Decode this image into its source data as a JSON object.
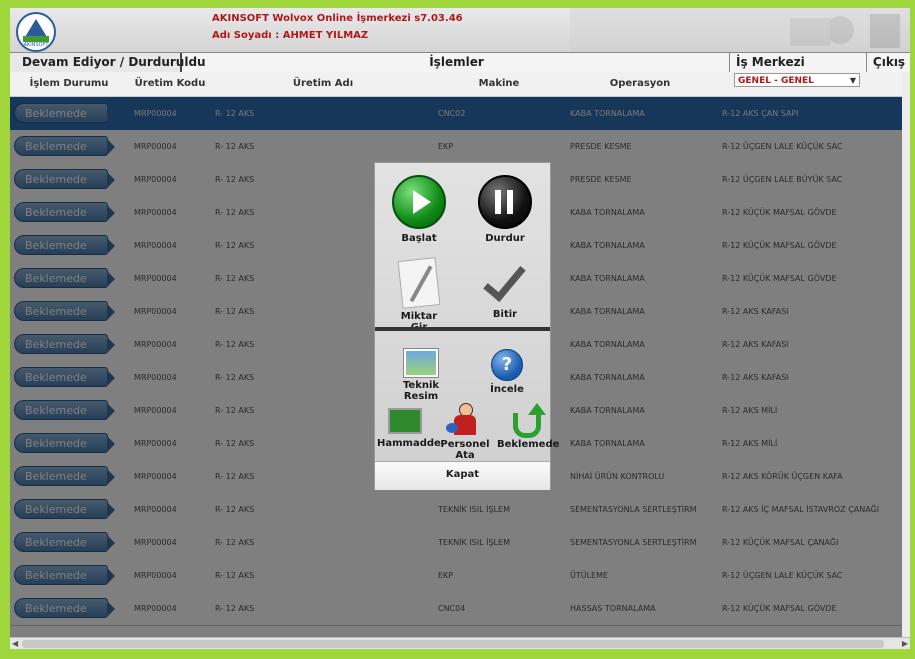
{
  "header": {
    "title": "AKINSOFT Wolvox Online İşmerkezi s7.03.46",
    "user_label": "Adı Soyadı : ",
    "user_name": "AHMET YILMAZ",
    "logo_text": "AKINSOFT"
  },
  "toolbar": {
    "status_tab": "Devam Ediyor / Durduruldu",
    "operations": "İşlemler",
    "work_center": "İş Merkezi",
    "exit": "Çıkış"
  },
  "columns": [
    "İşlem Durumu",
    "Üretim Kodu",
    "Üretim Adı",
    "Makine",
    "Operasyon"
  ],
  "work_center_select": {
    "value": "GENEL - GENEL"
  },
  "rows": [
    {
      "status": "Beklemede",
      "code": "MRP00004",
      "name": "R- 12 AKS",
      "machine": "CNC02",
      "operation": "KABA TORNALAMA",
      "item": "R-12 AKS ÇAN SAPI",
      "selected": true
    },
    {
      "status": "Beklemede",
      "code": "MRP00004",
      "name": "R- 12 AKS",
      "machine": "EKP",
      "operation": "PRESDE KESME",
      "item": "R-12 ÜÇGEN LALE KÜÇÜK SAC"
    },
    {
      "status": "Beklemede",
      "code": "MRP00004",
      "name": "R- 12 AKS",
      "machine": "",
      "operation": "PRESDE KESME",
      "item": "R-12 ÜÇGEN LALE BÜYÜK SAC"
    },
    {
      "status": "Beklemede",
      "code": "MRP00004",
      "name": "R- 12 AKS",
      "machine": "",
      "operation": "KABA TORNALAMA",
      "item": "R-12 KÜÇÜK MAFSAL GÖVDE"
    },
    {
      "status": "Beklemede",
      "code": "MRP00004",
      "name": "R- 12 AKS",
      "machine": "",
      "operation": "KABA TORNALAMA",
      "item": "R-12 KÜÇÜK MAFSAL GÖVDE"
    },
    {
      "status": "Beklemede",
      "code": "MRP00004",
      "name": "R- 12 AKS",
      "machine": "",
      "operation": "KABA TORNALAMA",
      "item": "R-12 KÜÇÜK MAFSAL GÖVDE"
    },
    {
      "status": "Beklemede",
      "code": "MRP00004",
      "name": "R- 12 AKS",
      "machine": "",
      "operation": "KABA TORNALAMA",
      "item": "R-12 AKS KAFASI"
    },
    {
      "status": "Beklemede",
      "code": "MRP00004",
      "name": "R- 12 AKS",
      "machine": "",
      "operation": "KABA TORNALAMA",
      "item": "R-12 AKS KAFASI"
    },
    {
      "status": "Beklemede",
      "code": "MRP00004",
      "name": "R- 12 AKS",
      "machine": "",
      "operation": "KABA TORNALAMA",
      "item": "R-12 AKS KAFASI"
    },
    {
      "status": "Beklemede",
      "code": "MRP00004",
      "name": "R- 12 AKS",
      "machine": "",
      "operation": "KABA TORNALAMA",
      "item": "R-12 AKS MİLİ"
    },
    {
      "status": "Beklemede",
      "code": "MRP00004",
      "name": "R- 12 AKS",
      "machine": "",
      "operation": "KABA TORNALAMA",
      "item": "R-12 AKS MİLİ"
    },
    {
      "status": "Beklemede",
      "code": "MRP00004",
      "name": "R- 12 AKS",
      "machine": "",
      "operation": "NİHAİ ÜRÜN KONTROLU",
      "item": "R-12 AKS KÖRÜK ÜÇGEN KAFA"
    },
    {
      "status": "Beklemede",
      "code": "MRP00004",
      "name": "R- 12 AKS",
      "machine": "TEKNİK ISIL İŞLEM",
      "operation": "SEMENTASYONLA SERTLEŞTİRM",
      "item": "R-12 AKS İÇ MAFSAL İSTAVROZ ÇANAĞI"
    },
    {
      "status": "Beklemede",
      "code": "MRP00004",
      "name": "R- 12 AKS",
      "machine": "TEKNİK ISIL İŞLEM",
      "operation": "SEMENTASYONLA SERTLEŞTİRM",
      "item": "R-12 KÜÇÜK MAFSAL ÇANAĞI"
    },
    {
      "status": "Beklemede",
      "code": "MRP00004",
      "name": "R- 12 AKS",
      "machine": "EKP",
      "operation": "ÜTÜLEME",
      "item": "R-12 ÜÇGEN LALE KÜÇÜK SAC"
    },
    {
      "status": "Beklemede",
      "code": "MRP00004",
      "name": "R- 12 AKS",
      "machine": "CNC04",
      "operation": "HASSAS TORNALAMA",
      "item": "R-12 KÜÇÜK MAFSAL GÖVDE"
    }
  ],
  "modal": {
    "start": "Başlat",
    "stop": "Durdur",
    "enter_qty": "Miktar Gir",
    "finish": "Bitir",
    "drawing_line1": "Teknik",
    "drawing_line2": "Resim",
    "inspect": "İncele",
    "material": "Hammadde",
    "assign_staff": "Personel Ata",
    "waiting": "Beklemede",
    "close": "Kapat"
  },
  "colors": {
    "accent_green": "#9fd63b",
    "selected_row": "#2d6eb3",
    "title_red": "#b01818"
  }
}
